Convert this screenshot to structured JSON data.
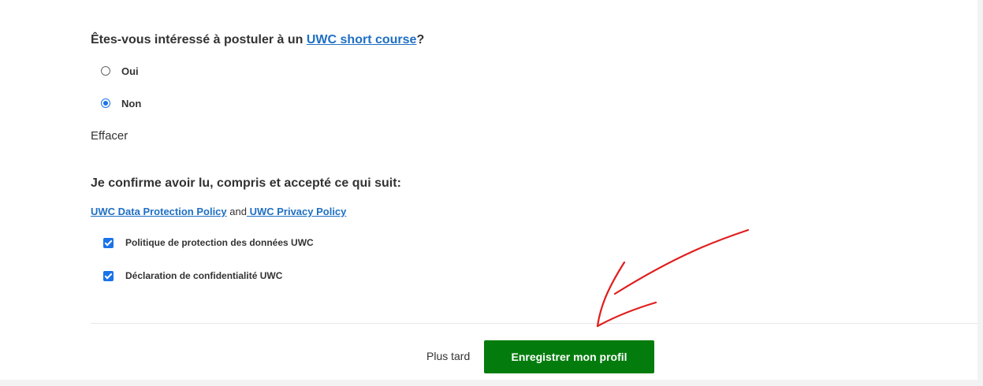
{
  "question": {
    "prefix": "Êtes-vous intéressé à postuler à un ",
    "link": "UWC short course",
    "suffix": "?",
    "options": [
      {
        "label": "Oui",
        "selected": false
      },
      {
        "label": "Non",
        "selected": true
      }
    ],
    "clear_label": "Effacer"
  },
  "confirmation": {
    "title": "Je confirme avoir lu, compris et accepté ce qui suit:",
    "policy_link_1": "UWC Data Protection Policy",
    "connector": " and",
    "policy_link_2": " UWC Privacy Policy",
    "checkboxes": [
      {
        "label": "Politique de protection des données UWC",
        "checked": true
      },
      {
        "label": "Déclaration de confidentialité UWC",
        "checked": true
      }
    ]
  },
  "footer": {
    "later_label": "Plus tard",
    "save_label": "Enregistrer mon profil",
    "save_color": "#037c0d"
  },
  "colors": {
    "link": "#1f6fc4",
    "accent": "#1a73e8",
    "annotation": "#e01e1e"
  },
  "icons": {
    "annotation_arrow": "red-arrow-icon"
  }
}
